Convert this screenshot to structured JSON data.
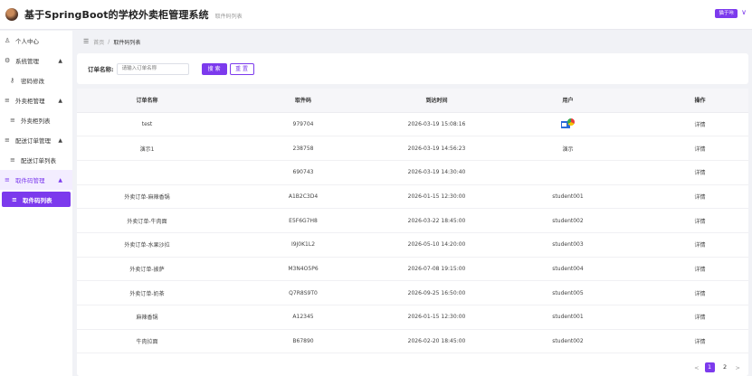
{
  "header": {
    "title": "基于SpringBoot的学校外卖柜管理系统",
    "crumb": "取件码列表",
    "user": "猫于咔",
    "caret": "∨"
  },
  "sidebar": {
    "items": [
      {
        "icon": "person-icon",
        "glyph": "♙",
        "label": "个人中心"
      },
      {
        "icon": "gear-icon",
        "glyph": "⚙",
        "label": "系统管理",
        "arrow": "▲"
      },
      {
        "icon": "key-icon",
        "glyph": "⚷",
        "label": "密码修改"
      },
      {
        "icon": "list-icon",
        "glyph": "≡",
        "label": "外卖柜管理",
        "arrow": "▲"
      },
      {
        "icon": "list-icon",
        "glyph": "≡",
        "label": "外卖柜列表"
      },
      {
        "icon": "list-icon",
        "glyph": "≡",
        "label": "配送订单管理",
        "arrow": "▲"
      },
      {
        "icon": "list-icon",
        "glyph": "≡",
        "label": "配送订单列表"
      },
      {
        "icon": "list-icon",
        "glyph": "≡",
        "label": "取件码管理",
        "arrow": "▲"
      },
      {
        "icon": "list-icon",
        "glyph": "≡",
        "label": "取件码列表"
      }
    ]
  },
  "breadcrumb": {
    "home": "首页",
    "sep": "/",
    "current": "取件码列表"
  },
  "search": {
    "label": "订单名称:",
    "placeholder": "请输入订单名称",
    "search_btn": "搜 索",
    "reset_btn": "重 置"
  },
  "table": {
    "headers": [
      "订单名称",
      "取件码",
      "到达时间",
      "用户",
      "操作"
    ],
    "rows": [
      {
        "name": "test",
        "code": "979704",
        "time": "2026-03-19 15:08:16",
        "user": "",
        "avatar": true,
        "action": "详情"
      },
      {
        "name": "演示1",
        "code": "238758",
        "time": "2026-03-19 14:56:23",
        "user": "演示",
        "avatar": false,
        "action": "详情"
      },
      {
        "name": "",
        "code": "690743",
        "time": "2026-03-19 14:30:40",
        "user": "",
        "avatar": false,
        "action": "详情"
      },
      {
        "name": "外卖订单-麻辣香锅",
        "code": "A1B2C3D4",
        "time": "2026-01-15 12:30:00",
        "user": "student001",
        "avatar": false,
        "action": "详情"
      },
      {
        "name": "外卖订单-牛肉面",
        "code": "E5F6G7H8",
        "time": "2026-03-22 18:45:00",
        "user": "student002",
        "avatar": false,
        "action": "详情"
      },
      {
        "name": "外卖订单-水果沙拉",
        "code": "I9J0K1L2",
        "time": "2026-05-10 14:20:00",
        "user": "student003",
        "avatar": false,
        "action": "详情"
      },
      {
        "name": "外卖订单-披萨",
        "code": "M3N4O5P6",
        "time": "2026-07-08 19:15:00",
        "user": "student004",
        "avatar": false,
        "action": "详情"
      },
      {
        "name": "外卖订单-奶茶",
        "code": "Q7R8S9T0",
        "time": "2026-09-25 16:50:00",
        "user": "student005",
        "avatar": false,
        "action": "详情"
      },
      {
        "name": "麻辣香锅",
        "code": "A12345",
        "time": "2026-01-15 12:30:00",
        "user": "student001",
        "avatar": false,
        "action": "详情"
      },
      {
        "name": "牛肉拉面",
        "code": "B67890",
        "time": "2026-02-20 18:45:00",
        "user": "student002",
        "avatar": false,
        "action": "详情"
      }
    ]
  },
  "pager": {
    "prev": "<",
    "pages": [
      "1",
      "2"
    ],
    "active": 0,
    "next": ">"
  },
  "colors": {
    "accent": "#7c3aed"
  }
}
